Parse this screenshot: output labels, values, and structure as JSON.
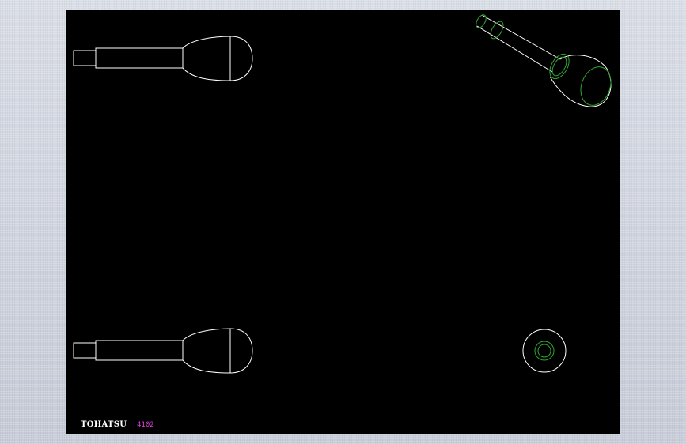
{
  "drawing": {
    "brand_text": "TOHATSU",
    "part_number": "4102",
    "background_color": "#000000",
    "outline_color": "#ffffff",
    "hidden_edge_color": "#2fa52f",
    "label_color": "#e040e0"
  }
}
